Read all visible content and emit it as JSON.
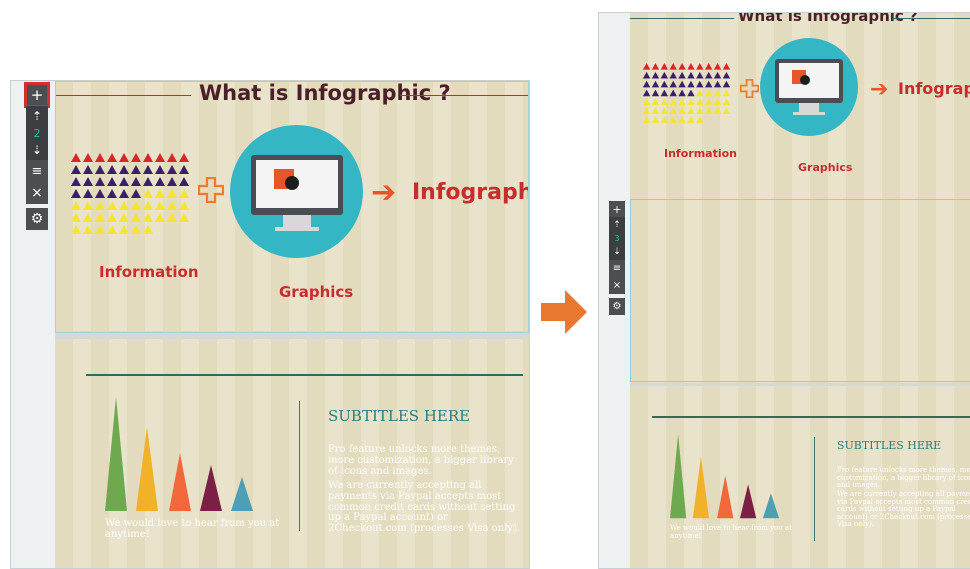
{
  "page": {
    "title": "What is Infographic ?",
    "information_label": "Information",
    "graphics_label": "Graphics",
    "infographic_label": "Infographic",
    "subtitle": "SUBTITLES HERE",
    "paragraph_1": "Pro feature unlocks more themes, more customization, a bigger library of icons and images.",
    "paragraph_2": "We are currently accepting all payments via Paypal accepts most common credit cards without setting up a Paypal account) or 2Checkout.com (processes Visa only).",
    "footer_text": "We would love to hear from you at anytime!"
  },
  "toolbar_left": {
    "add": "+",
    "move_up": "⇡",
    "number": "2",
    "move_down": "⇣",
    "layout": "≡",
    "delete": "×",
    "settings": "⚙"
  },
  "toolbar_right": {
    "add": "+",
    "move_up": "⇡",
    "number": "3",
    "move_down": "⇣",
    "layout": "≡",
    "delete": "×",
    "settings": "⚙"
  },
  "colors": {
    "page_background": "#e3dbbd",
    "accent_red": "#c62d2d",
    "title_color": "#4a1f29",
    "teal": "#35b6c4",
    "subtitle_teal": "#2a7f7a",
    "highlight_red": "#d32f2f",
    "toolbar_gray": "#4b4f51",
    "arrow_orange": "#e8772f"
  }
}
